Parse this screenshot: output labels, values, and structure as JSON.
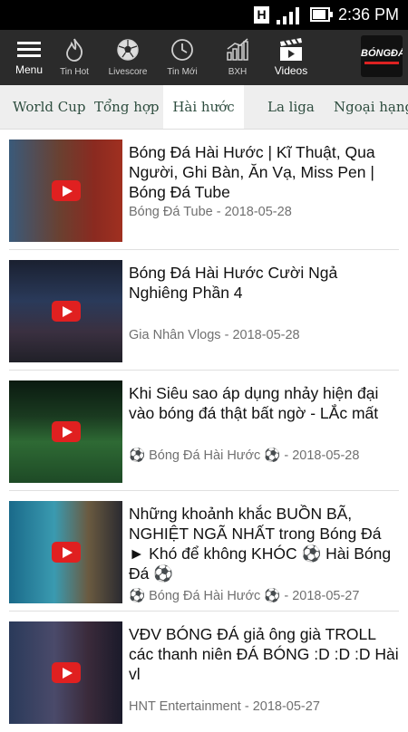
{
  "status_bar": {
    "time": "2:36 PM",
    "h_indicator": "H",
    "battery_level": 0.9
  },
  "toolbar": {
    "menu_label": "Menu",
    "items": [
      {
        "label": "Tin Hot",
        "icon": "flame-icon"
      },
      {
        "label": "Livescore",
        "icon": "soccer-ball-icon"
      },
      {
        "label": "Tin Mới",
        "icon": "clock-icon"
      },
      {
        "label": "BXH",
        "icon": "bar-chart-icon"
      },
      {
        "label": "Videos",
        "icon": "clapperboard-icon"
      }
    ],
    "logo_text": "BÓNGĐÁ"
  },
  "tabs": [
    {
      "label": "World Cup"
    },
    {
      "label": "Tổng hợp"
    },
    {
      "label": "Hài hước",
      "active": true
    },
    {
      "label": "La liga"
    },
    {
      "label": "Ngoại hạng"
    }
  ],
  "videos": [
    {
      "title": "Bóng Đá Hài Hước | Kĩ Thuật, Qua Người, Ghi Bàn, Ăn Vạ, Miss Pen | Bóng Đá Tube",
      "meta": "Bóng Đá Tube - 2018-05-28"
    },
    {
      "title": "Bóng Đá Hài Hước Cười Ngả Nghiêng Phần 4",
      "meta": "Gia Nhân Vlogs - 2018-05-28"
    },
    {
      "title": "Khi Siêu sao áp dụng nhảy hiện đại vào bóng đá thật bất ngờ - LẮc mất",
      "meta": "⚽ Bóng Đá Hài Hước ⚽ - 2018-05-28"
    },
    {
      "title": "Những khoảnh khắc BUỒN BÃ, NGHIỆT NGÃ NHẤT trong Bóng Đá ► Khó để không KHÓC ⚽ Hài Bóng Đá ⚽",
      "meta": "⚽ Bóng Đá Hài Hước ⚽ - 2018-05-27"
    },
    {
      "title": "VĐV BÓNG ĐÁ giả ông già TROLL các thanh niên ĐÁ BÓNG :D :D :D Hài vl",
      "meta": "HNT Entertainment - 2018-05-27"
    }
  ]
}
